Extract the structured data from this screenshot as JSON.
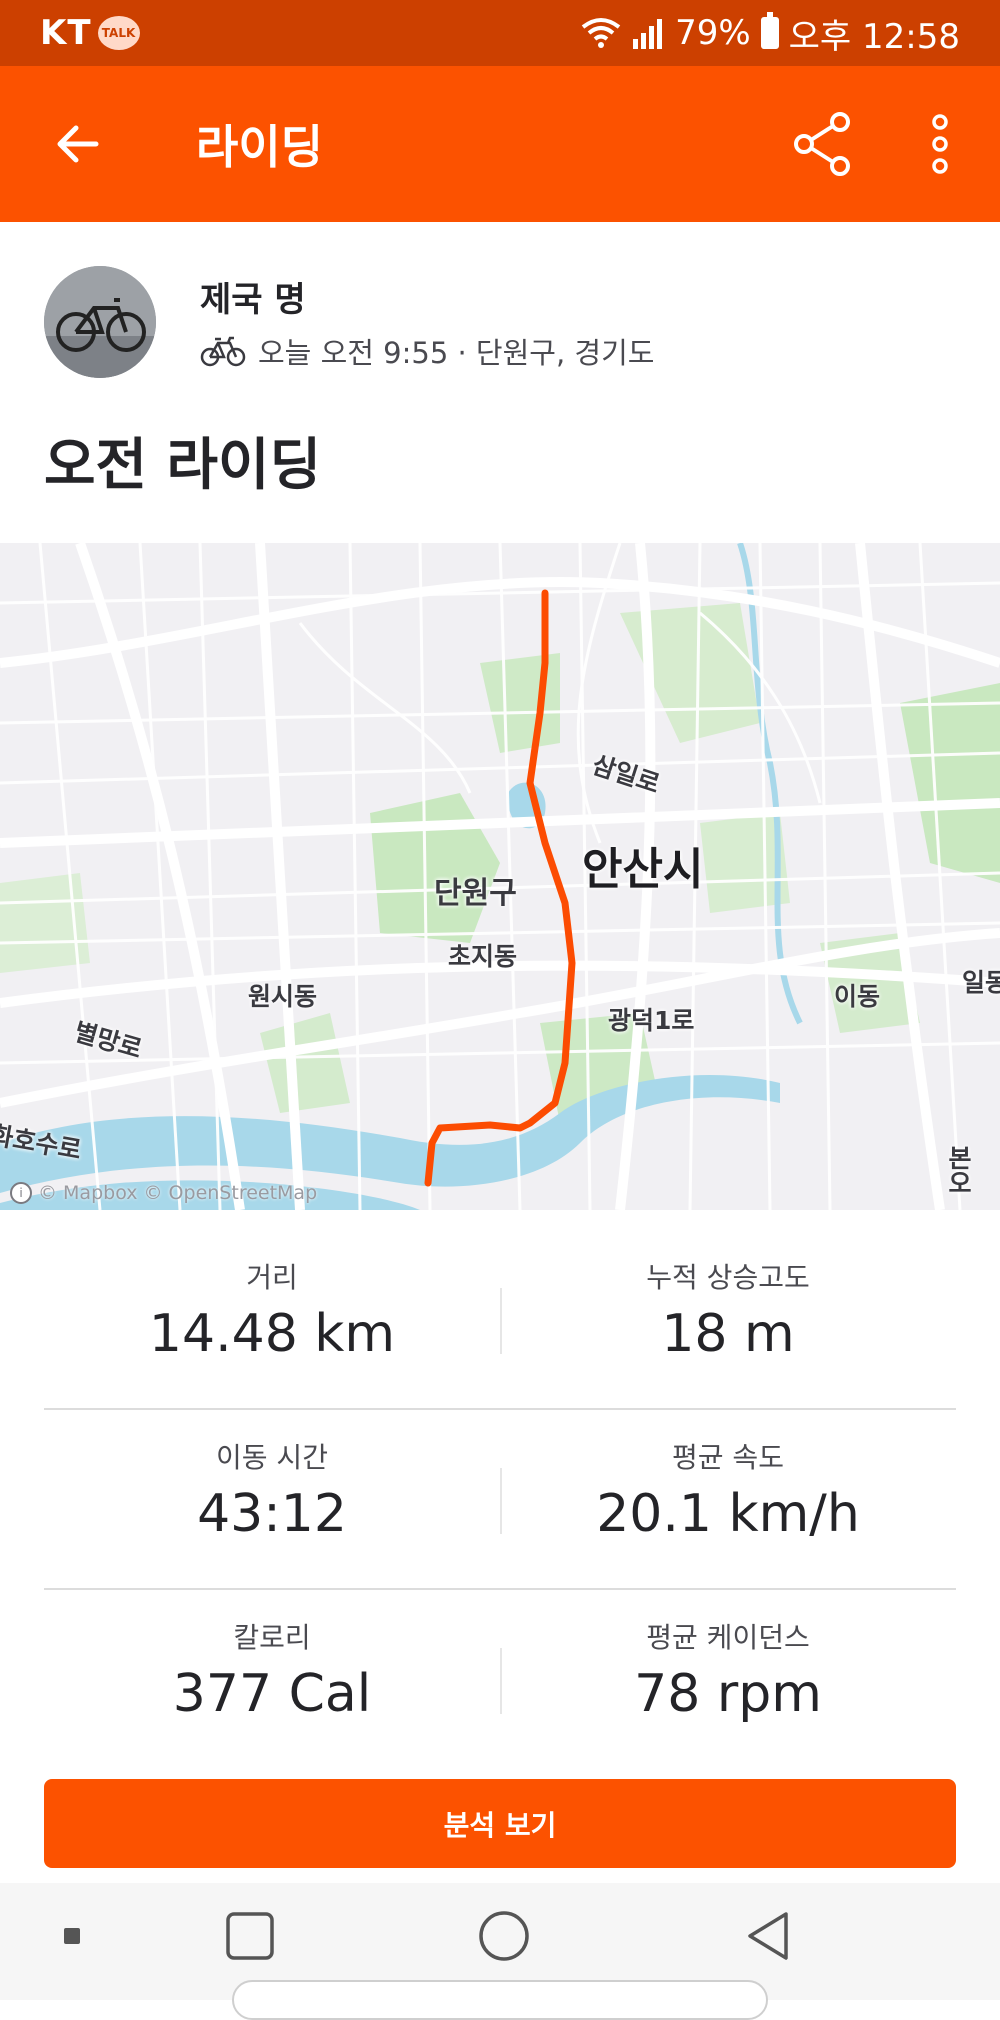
{
  "status_bar": {
    "carrier": "KT",
    "talk_badge": "TALK",
    "battery": "79%",
    "time": "오후 12:58"
  },
  "app_bar": {
    "title": "라이딩",
    "back_icon": "arrow-left-icon",
    "share_icon": "share-icon",
    "more_icon": "more-vertical-icon"
  },
  "activity": {
    "athlete_name": "제국 명",
    "sport_icon": "bicycle-icon",
    "meta": "오늘 오전 9:55 · 단원구, 경기도",
    "title": "오전 라이딩"
  },
  "map": {
    "labels": {
      "ansan": "안산시",
      "danwon": "단원구",
      "samil": "삼일로",
      "chojidong": "초지동",
      "wonsidong": "원시동",
      "byeolmang": "별망로",
      "gwangdeok": "광덕1로",
      "idong": "이동",
      "il": "일동",
      "lake": "화호수로",
      "bon": "본오"
    },
    "attribution": "© Mapbox © OpenStreetMap",
    "route_color": "#fc4c02"
  },
  "stats": [
    {
      "label": "거리",
      "value": "14.48 km"
    },
    {
      "label": "누적 상승고도",
      "value": "18 m"
    },
    {
      "label": "이동 시간",
      "value": "43:12"
    },
    {
      "label": "평균 속도",
      "value": "20.1 km/h"
    },
    {
      "label": "칼로리",
      "value": "377 Cal"
    },
    {
      "label": "평균 케이던스",
      "value": "78 rpm"
    }
  ],
  "analyze_button": "분석 보기",
  "colors": {
    "brand": "#fc5200",
    "status_bar": "#cc4000"
  },
  "nav_bar": {
    "recents_icon": "square-icon",
    "home_icon": "circle-icon",
    "back_icon": "triangle-back-icon",
    "dot_icon": "small-square-icon"
  }
}
